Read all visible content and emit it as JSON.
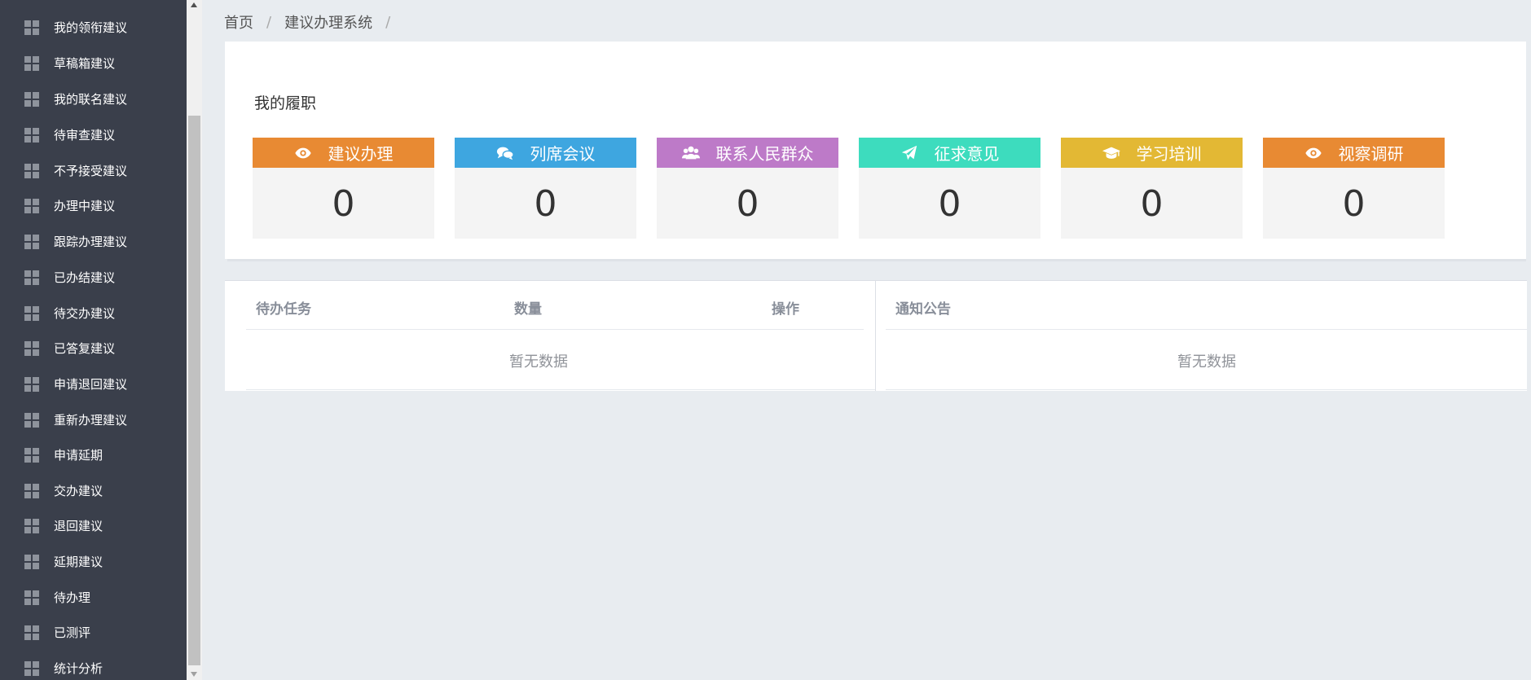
{
  "sidebar": {
    "items": [
      {
        "label": "我的领衔建议"
      },
      {
        "label": "草稿箱建议"
      },
      {
        "label": "我的联名建议"
      },
      {
        "label": "待审查建议"
      },
      {
        "label": "不予接受建议"
      },
      {
        "label": "办理中建议"
      },
      {
        "label": "跟踪办理建议"
      },
      {
        "label": "已办结建议"
      },
      {
        "label": "待交办建议"
      },
      {
        "label": "已答复建议"
      },
      {
        "label": "申请退回建议"
      },
      {
        "label": "重新办理建议"
      },
      {
        "label": "申请延期"
      },
      {
        "label": "交办建议"
      },
      {
        "label": "退回建议"
      },
      {
        "label": "延期建议"
      },
      {
        "label": "待办理"
      },
      {
        "label": "已测评"
      },
      {
        "label": "统计分析"
      }
    ],
    "item_icon": "grid-icon"
  },
  "breadcrumb": {
    "items": [
      "首页",
      "建议办理系统"
    ],
    "separator": "/"
  },
  "performance": {
    "title": "我的履职",
    "cards": [
      {
        "label": "建议办理",
        "value": "0",
        "icon": "eye-icon",
        "color": "#e88a33"
      },
      {
        "label": "列席会议",
        "value": "0",
        "icon": "comments-icon",
        "color": "#3ea6e0"
      },
      {
        "label": "联系人民群众",
        "value": "0",
        "icon": "users-icon",
        "color": "#bd7ac8"
      },
      {
        "label": "征求意见",
        "value": "0",
        "icon": "paper-plane-icon",
        "color": "#3ddcbe"
      },
      {
        "label": "学习培训",
        "value": "0",
        "icon": "graduation-cap-icon",
        "color": "#e3b834"
      },
      {
        "label": "视察调研",
        "value": "0",
        "icon": "eye-icon",
        "color": "#e88a33"
      }
    ]
  },
  "tasks": {
    "columns": [
      "待办任务",
      "数量",
      "操作"
    ],
    "empty_text": "暂无数据"
  },
  "notice": {
    "title": "通知公告",
    "empty_text": "暂无数据"
  },
  "colors": {
    "sidebar_bg": "#3a3f4b",
    "page_bg": "#e8ecf0"
  }
}
